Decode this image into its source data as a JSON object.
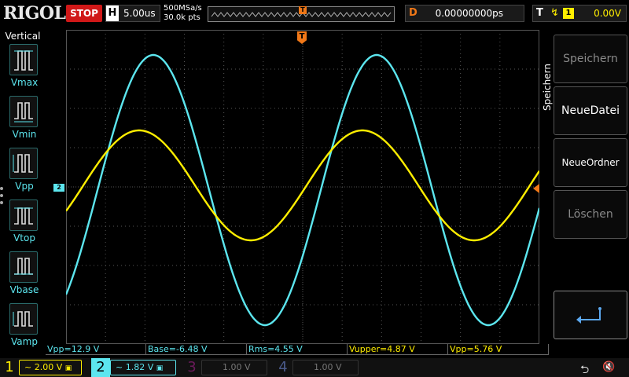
{
  "header": {
    "brand": "RIGOL",
    "run_state": "STOP",
    "horizontal": {
      "letter": "H",
      "timebase": "5.00us"
    },
    "sample_rate": "500MSa/s",
    "memory_depth": "30.0k pts",
    "memory_marker": "T",
    "delay": {
      "letter": "D",
      "value": "0.00000000ps"
    },
    "trigger": {
      "letter": "T",
      "source": "1",
      "level": "0.00V"
    }
  },
  "left_menu": {
    "title": "Vertical",
    "items": [
      {
        "label": "Vmax",
        "icon": "vmax-icon"
      },
      {
        "label": "Vmin",
        "icon": "vmin-icon"
      },
      {
        "label": "Vpp",
        "icon": "vpp-icon"
      },
      {
        "label": "Vtop",
        "icon": "vtop-icon"
      },
      {
        "label": "Vbase",
        "icon": "vbase-icon"
      },
      {
        "label": "Vamp",
        "icon": "vamp-icon"
      }
    ]
  },
  "waveform": {
    "trigger_marker": "T",
    "ch2_level_marker": "2",
    "colors": {
      "ch1": "#ffee00",
      "ch2": "#5ce6ef",
      "grid": "#555555"
    }
  },
  "right_menu": {
    "title": "Speichern",
    "buttons": [
      {
        "label": "Speichern",
        "enabled": false
      },
      {
        "label": "NeueDatei",
        "enabled": true
      },
      {
        "label": "NeueOrdner",
        "enabled": true
      },
      {
        "label": "Löschen",
        "enabled": false
      }
    ],
    "enter_icon": "enter-arrow-icon"
  },
  "measurements": [
    {
      "text": "Vpp=12.9 V",
      "channel": 2
    },
    {
      "text": "Base=-6.48 V",
      "channel": 2
    },
    {
      "text": "Rms=4.55 V",
      "channel": 2
    },
    {
      "text": "Vupper=4.87 V",
      "channel": 1
    },
    {
      "text": "Vpp=5.76 V",
      "channel": 1
    }
  ],
  "channels": [
    {
      "num": "1",
      "scale": "2.00 V"
    },
    {
      "num": "2",
      "scale": "1.82 V"
    },
    {
      "num": "3",
      "scale": "1.00 V"
    },
    {
      "num": "4",
      "scale": "1.00 V"
    }
  ]
}
